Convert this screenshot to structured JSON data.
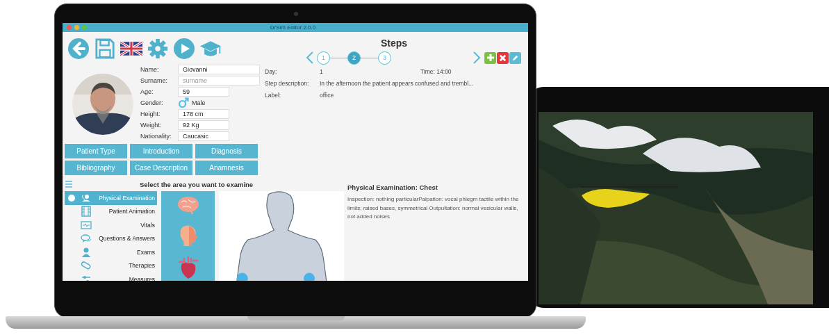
{
  "window": {
    "title": "DrSim Editor 2.0.0"
  },
  "patient": {
    "fields": [
      {
        "label": "Name:",
        "kind": "text",
        "value": "Giovanni"
      },
      {
        "label": "Surname:",
        "kind": "text",
        "placeholder": "surname"
      },
      {
        "label": "Age:",
        "kind": "short",
        "value": "59"
      },
      {
        "label": "Gender:",
        "kind": "gender",
        "value": "Male"
      },
      {
        "label": "Height:",
        "kind": "short",
        "value": "178 cm"
      },
      {
        "label": "Weight:",
        "kind": "short",
        "value": "92 Kg"
      },
      {
        "label": "Nationality:",
        "kind": "short",
        "value": "Caucasic"
      }
    ]
  },
  "section_buttons": [
    "Patient Type",
    "Introduction",
    "Diagnosis",
    "Bibliography",
    "Case Description",
    "Anamnesis"
  ],
  "steps": {
    "title": "Steps",
    "items": [
      {
        "label": "1",
        "selected": false
      },
      {
        "label": "2",
        "selected": true
      },
      {
        "label": "3",
        "selected": false
      }
    ],
    "day_label": "Day:",
    "day": "1",
    "time_label": "Time:",
    "time": "14:00",
    "details": [
      {
        "label": "Step description:",
        "value": "In the afternoon the patient appears confused and trembl..."
      },
      {
        "label": "Label:",
        "value": "office"
      }
    ]
  },
  "menu": [
    {
      "label": "Physical Examination",
      "selected": true
    },
    {
      "label": "Patient Animation",
      "selected": false
    },
    {
      "label": "Vitals",
      "selected": false
    },
    {
      "label": "Questions & Answers",
      "selected": false
    },
    {
      "label": "Exams",
      "selected": false
    },
    {
      "label": "Therapies",
      "selected": false
    },
    {
      "label": "Measures",
      "selected": false
    }
  ],
  "examine": {
    "title": "Select the area you want to examine"
  },
  "result": {
    "title": "Physical Examination: Chest",
    "text": "Inspection: nothing particularPalpation: vocal phlegm tactile within the limits; raised bases, symmetrical Outpultation: normal vesicular walls, not added noises"
  },
  "tablet": {
    "kind": "picture"
  }
}
